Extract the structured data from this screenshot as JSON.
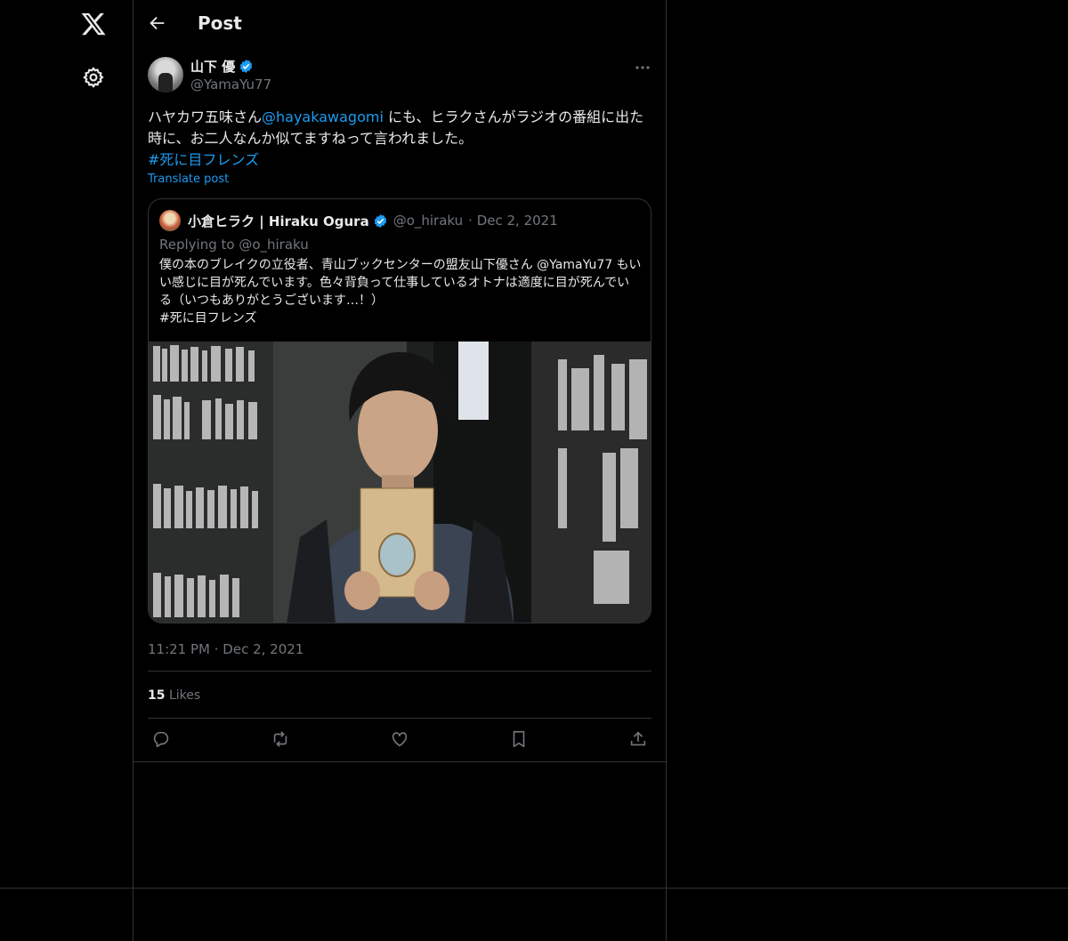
{
  "header": {
    "title": "Post"
  },
  "post": {
    "author_name": "山下 優",
    "handle": "@YamaYu77",
    "text_before_link": "ハヤカワ五味さん",
    "mention": "@hayakawagomi",
    "text_after_link": " にも、ヒラクさんがラジオの番組に出た時に、お二人なんか似てますねって言われました。",
    "hashtag": "#死に目フレンズ",
    "translate_label": "Translate post",
    "timestamp": "11:21 PM · Dec 2, 2021",
    "likes_count": "15",
    "likes_label": "Likes"
  },
  "quote": {
    "author_name": "小倉ヒラク | Hiraku Ogura",
    "handle": "@o_hiraku",
    "date": "· Dec 2, 2021",
    "replying_to": "Replying to @o_hiraku",
    "text": "僕の本のブレイクの立役者、青山ブックセンターの盟友山下優さん @YamaYu77 もいい感じに目が死んでいます。色々背負って仕事しているオトナは適度に目が死んでいる（いつもありがとうございます…！）\n#死に目フレンズ"
  },
  "icons": {
    "logo": "x-logo-icon",
    "settings": "gear-icon",
    "back": "arrow-left-icon",
    "verified": "verified-badge-icon",
    "more": "more-icon",
    "reply": "reply-icon",
    "repost": "repost-icon",
    "like": "heart-icon",
    "bookmark": "bookmark-icon",
    "share": "share-icon"
  },
  "colors": {
    "accent": "#1d9bf0",
    "background": "#000000",
    "muted": "#71767b",
    "border": "#2f3336"
  }
}
